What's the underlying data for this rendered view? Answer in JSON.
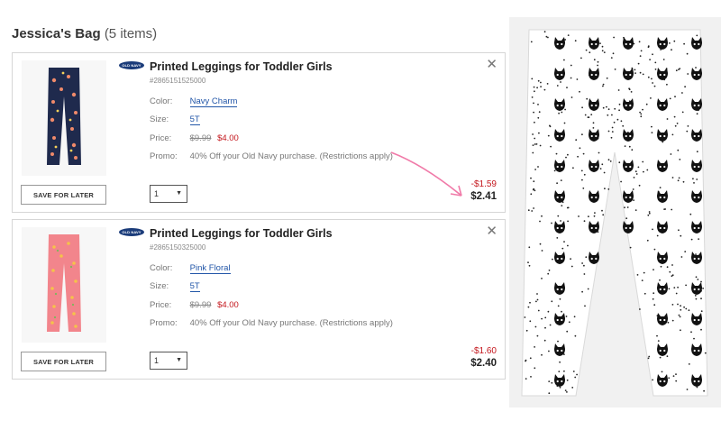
{
  "bag": {
    "title": "Jessica's Bag",
    "count": "(5 items)"
  },
  "items": [
    {
      "brand": "OLD NAVY",
      "name": "Printed Leggings for Toddler Girls",
      "sku": "#2865151525000",
      "color_label": "Color:",
      "color": "Navy Charm",
      "size_label": "Size:",
      "size": "5T",
      "price_label": "Price:",
      "price_original": "$9.99",
      "price_sale": "$4.00",
      "promo_label": "Promo:",
      "promo": "40% Off your Old Navy purchase. (Restrictions apply)",
      "save_label": "SAVE FOR LATER",
      "qty": "1",
      "discount": "-$1.59",
      "total": "$2.41",
      "thumb_color": "#1f2a4d"
    },
    {
      "brand": "OLD NAVY",
      "name": "Printed Leggings for Toddler Girls",
      "sku": "#2865150325000",
      "color_label": "Color:",
      "color": "Pink Floral",
      "size_label": "Size:",
      "size": "5T",
      "price_label": "Price:",
      "price_original": "$9.99",
      "price_sale": "$4.00",
      "promo_label": "Promo:",
      "promo": "40% Off your Old Navy purchase. (Restrictions apply)",
      "save_label": "SAVE FOR LATER",
      "qty": "1",
      "discount": "-$1.60",
      "total": "$2.40",
      "thumb_color": "#f2858c"
    }
  ],
  "colors": {
    "accent_red": "#c4161c",
    "link_blue": "#2256a8",
    "annotation_pink": "#f07aa8"
  },
  "icons": {
    "close": "close-icon",
    "caret": "chevron-down-icon"
  }
}
